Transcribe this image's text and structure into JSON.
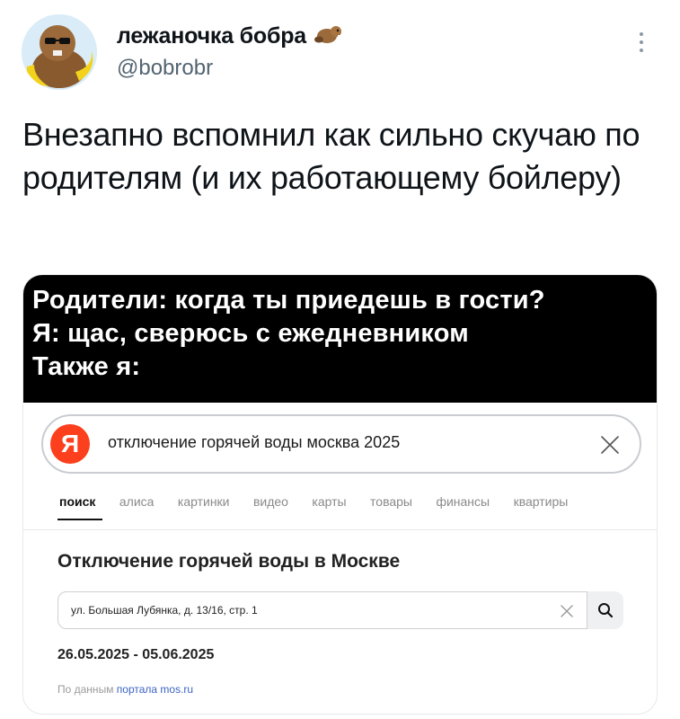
{
  "tweet": {
    "author_name": "лежаночка бобра",
    "author_emoji_icon": "beaver-icon",
    "handle": "@bobrobr",
    "text": "Внезапно вспомнил как сильно скучаю по родителям (и их работающему бойлеру)"
  },
  "meme": {
    "lines": [
      "Родители: когда ты приедешь в гости?",
      "Я: щас, сверюсь с ежедневником",
      "Также я:"
    ]
  },
  "yandex": {
    "logo_letter": "Я",
    "query": "отключение горячей воды москва 2025",
    "tabs": [
      "поиск",
      "алиса",
      "картинки",
      "видео",
      "карты",
      "товары",
      "финансы",
      "квартиры"
    ],
    "active_tab": "поиск",
    "result_title": "Отключение горячей воды в Москве",
    "address_value": "ул. Большая Лубянка, д. 13/16, стр. 1",
    "dates": "26.05.2025 - 05.06.2025",
    "source_prefix": "По данным",
    "source_link": "портала mos.ru",
    "accent_color": "#fc3f1d"
  }
}
